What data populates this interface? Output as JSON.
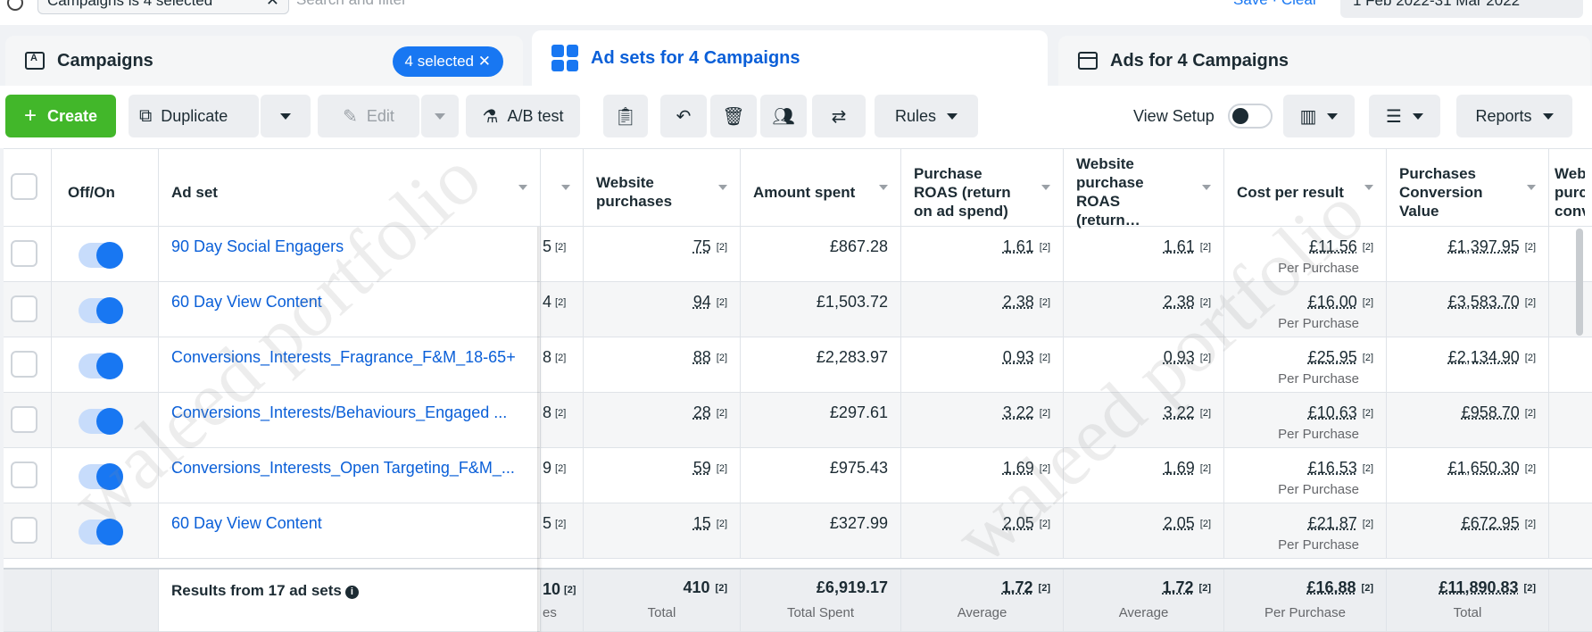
{
  "search": {
    "filter_chip": "Campaigns is 4 selected",
    "placeholder": "Search and filter",
    "save_clear": "Save · Clear",
    "date_range": "1 Feb 2022-31 Mar 2022"
  },
  "tabs": {
    "campaigns": {
      "label": "Campaigns",
      "selected": "4 selected"
    },
    "adsets": {
      "label": "Ad sets for 4 Campaigns"
    },
    "ads": {
      "label": "Ads for 4 Campaigns"
    }
  },
  "toolbar": {
    "create": "Create",
    "duplicate": "Duplicate",
    "edit": "Edit",
    "ab_test": "A/B test",
    "rules": "Rules",
    "view_setup": "View Setup",
    "reports": "Reports"
  },
  "columns": {
    "off_on": "Off/On",
    "ad_set": "Ad set",
    "website_purchases": "Website purchases",
    "amount_spent": "Amount spent",
    "purchase_roas": "Purchase ROAS (return on ad spend)",
    "website_purchase_roas": "Website purchase ROAS (return…",
    "cost_per_result": "Cost per result",
    "purchases_conversion_value": "Purchases Conversion Value",
    "partial_right": "Web purc conv"
  },
  "rows": [
    {
      "name": "90 Day Social Engagers",
      "partial": "5",
      "purchases": "75",
      "spent": "£867.28",
      "roas": "1.61",
      "web_roas": "1.61",
      "cpr": "£11.56",
      "cpr_sub": "Per Purchase",
      "conv_value": "£1,397.95"
    },
    {
      "name": "60 Day View Content",
      "partial": "4",
      "purchases": "94",
      "spent": "£1,503.72",
      "roas": "2.38",
      "web_roas": "2.38",
      "cpr": "£16.00",
      "cpr_sub": "Per Purchase",
      "conv_value": "£3,583.70"
    },
    {
      "name": "Conversions_Interests_Fragrance_F&M_18-65+",
      "partial": "8",
      "purchases": "88",
      "spent": "£2,283.97",
      "roas": "0.93",
      "web_roas": "0.93",
      "cpr": "£25.95",
      "cpr_sub": "Per Purchase",
      "conv_value": "£2,134.90"
    },
    {
      "name": "Conversions_Interests/Behaviours_Engaged ...",
      "partial": "8",
      "purchases": "28",
      "spent": "£297.61",
      "roas": "3.22",
      "web_roas": "3.22",
      "cpr": "£10.63",
      "cpr_sub": "Per Purchase",
      "conv_value": "£958.70"
    },
    {
      "name": "Conversions_Interests_Open Targeting_F&M_...",
      "partial": "9",
      "purchases": "59",
      "spent": "£975.43",
      "roas": "1.69",
      "web_roas": "1.69",
      "cpr": "£16.53",
      "cpr_sub": "Per Purchase",
      "conv_value": "£1,650.30"
    },
    {
      "name": "60 Day View Content",
      "partial": "5",
      "purchases": "15",
      "spent": "£327.99",
      "roas": "2.05",
      "web_roas": "2.05",
      "cpr": "£21.87",
      "cpr_sub": "Per Purchase",
      "conv_value": "£672.95"
    }
  ],
  "ref": "[2]",
  "footer": {
    "label": "Results from 17 ad sets",
    "partial": "10",
    "partial_sub": "es",
    "purchases": "410",
    "purchases_sub": "Total",
    "spent": "£6,919.17",
    "spent_sub": "Total Spent",
    "roas": "1.72",
    "roas_sub": "Average",
    "web_roas": "1.72",
    "web_roas_sub": "Average",
    "cpr": "£16.88",
    "cpr_sub": "Per Purchase",
    "conv_value": "£11,890.83",
    "conv_value_sub": "Total"
  },
  "watermark": "waleed portfolio",
  "colors": {
    "accent": "#1877f2",
    "create": "#42b72a",
    "link": "#0a5fd8"
  }
}
